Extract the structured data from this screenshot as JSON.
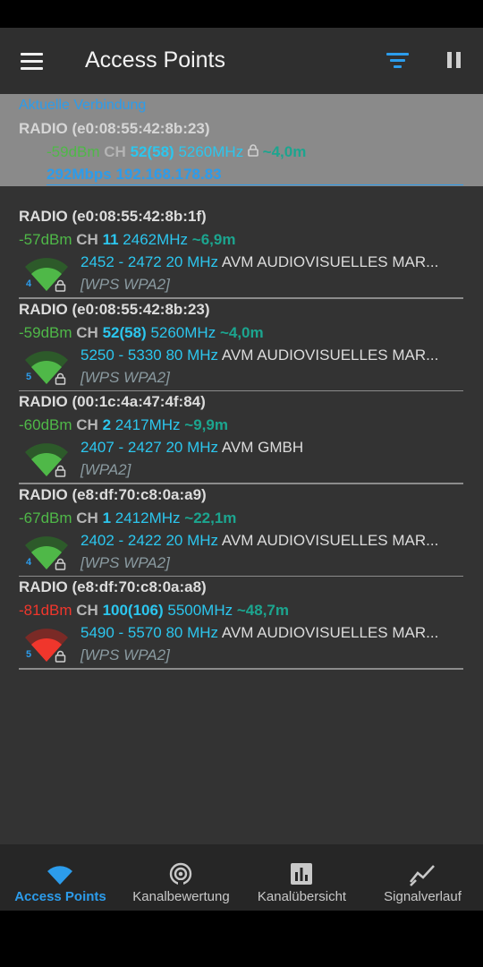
{
  "app": {
    "title": "Access Points"
  },
  "current": {
    "heading": "Aktuelle Verbindung",
    "name": "RADIO (e0:08:55:42:8b:23)",
    "dbm": "-59dBm",
    "ch_label": "CH",
    "channel": "52(58)",
    "freq": "5260MHz",
    "dist": "~4,0m",
    "speed_ip": "292Mbps 192.168.178.83"
  },
  "access_points": [
    {
      "name": "RADIO (e0:08:55:42:8b:1f)",
      "dbm": "-57dBm",
      "dbm_color": "#4fb848",
      "ch_label": "CH",
      "channel": "11",
      "freq": "2462MHz",
      "dist": "~6,9m",
      "range": "2452 - 2472 20 MHz",
      "vendor": "AVM AUDIOVISUELLES MAR...",
      "security": "[WPS WPA2]",
      "icon_num": "4",
      "icon_color": "#4fb848",
      "locked": true
    },
    {
      "name": "RADIO (e0:08:55:42:8b:23)",
      "dbm": "-59dBm",
      "dbm_color": "#4fb848",
      "ch_label": "CH",
      "channel": "52(58)",
      "freq": "5260MHz",
      "dist": "~4,0m",
      "range": "5250 - 5330 80 MHz",
      "vendor": "AVM AUDIOVISUELLES MAR...",
      "security": "[WPS WPA2]",
      "icon_num": "5",
      "icon_color": "#4fb848",
      "locked": true
    },
    {
      "name": "RADIO (00:1c:4a:47:4f:84)",
      "dbm": "-60dBm",
      "dbm_color": "#4fb848",
      "ch_label": "CH",
      "channel": "2",
      "freq": "2417MHz",
      "dist": "~9,9m",
      "range": "2407 - 2427 20 MHz",
      "vendor": "AVM GMBH",
      "security": "[WPA2]",
      "icon_num": "",
      "icon_color": "#4fb848",
      "locked": true
    },
    {
      "name": "RADIO (e8:df:70:c8:0a:a9)",
      "dbm": "-67dBm",
      "dbm_color": "#4fb848",
      "ch_label": "CH",
      "channel": "1",
      "freq": "2412MHz",
      "dist": "~22,1m",
      "range": "2402 - 2422 20 MHz",
      "vendor": "AVM AUDIOVISUELLES MAR...",
      "security": "[WPS WPA2]",
      "icon_num": "4",
      "icon_color": "#4fb848",
      "locked": true
    },
    {
      "name": "RADIO (e8:df:70:c8:0a:a8)",
      "dbm": "-81dBm",
      "dbm_color": "#f0362c",
      "ch_label": "CH",
      "channel": "100(106)",
      "freq": "5500MHz",
      "dist": "~48,7m",
      "range": "5490 - 5570 80 MHz",
      "vendor": "AVM AUDIOVISUELLES MAR...",
      "security": "[WPS WPA2]",
      "icon_num": "5",
      "icon_color": "#f0362c",
      "locked": true
    }
  ],
  "nav": [
    {
      "label": "Access Points",
      "icon": "wifi-icon",
      "active": true
    },
    {
      "label": "Kanalbewertung",
      "icon": "radar-icon",
      "active": false
    },
    {
      "label": "Kanalübersicht",
      "icon": "bar-chart-icon",
      "active": false
    },
    {
      "label": "Signalverlauf",
      "icon": "line-chart-icon",
      "active": false
    }
  ],
  "colors": {
    "accent": "#2c9ceb",
    "green": "#4fb848",
    "red": "#f0362c"
  }
}
